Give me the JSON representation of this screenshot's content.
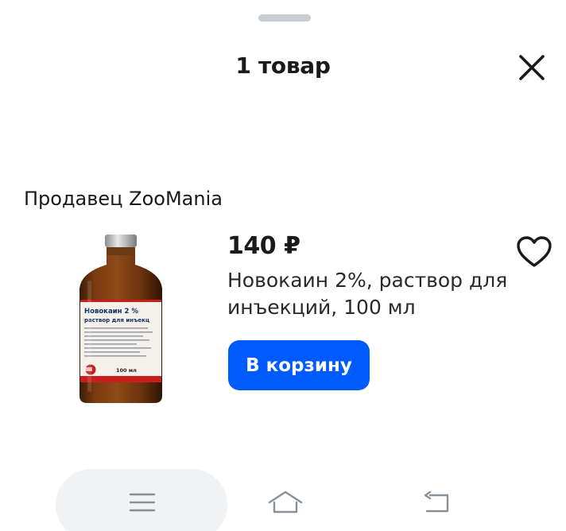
{
  "header": {
    "title": "1 товар",
    "close_icon": "close-icon"
  },
  "seller": {
    "label": "Продавец ZooMania"
  },
  "product": {
    "price": "140 ₽",
    "name": "Новокаин 2%, раствор для инъекций, 100 мл",
    "favorite_icon": "heart-outline-icon",
    "cart_button_label": "В корзину",
    "image": {
      "label_line1": "Новокаин 2 %",
      "label_line2": "раствор для инъекц",
      "volume": "100 мл"
    }
  },
  "system_nav": {
    "items": [
      "menu-icon",
      "home-icon",
      "back-icon"
    ]
  },
  "colors": {
    "accent": "#005bff",
    "text": "#1a1a1a",
    "grabber": "#c9ccd2",
    "nav_pill": "#f1f2f4"
  }
}
